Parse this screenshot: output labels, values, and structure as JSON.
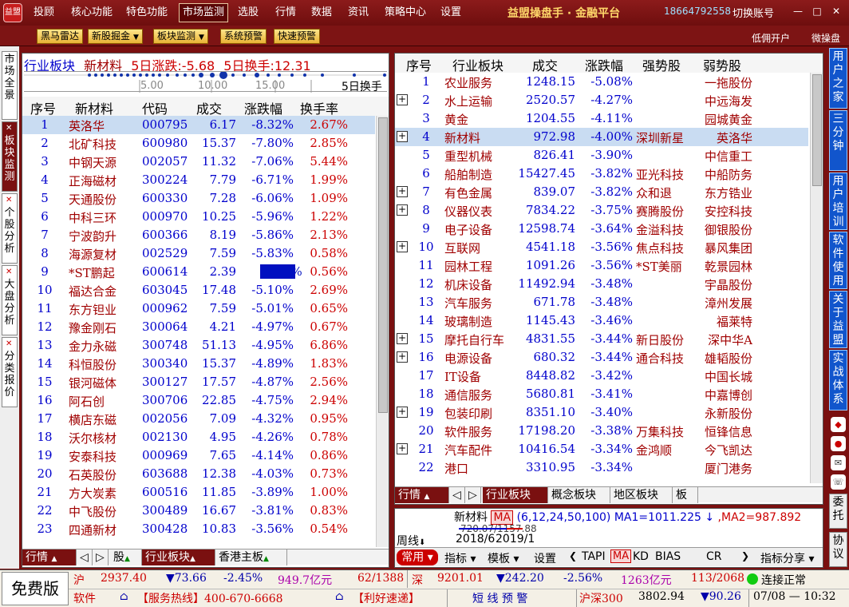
{
  "menu": {
    "logo": "益盟",
    "items": [
      "投顾",
      "核心功能",
      "特色功能",
      "市场监测",
      "选股",
      "行情",
      "数据",
      "资讯",
      "策略中心",
      "设置"
    ],
    "active": "市场监测",
    "brand": "益盟操盘手 · 金融平台",
    "phone": "18664792558",
    "switch_account": "切换账号",
    "window_buttons": [
      "—",
      "□",
      "✕"
    ]
  },
  "toolbar": {
    "buttons": [
      "黑马雷达",
      "新股掘金",
      "板块监测",
      "系统预警",
      "快速预警"
    ],
    "links": [
      "低佣开户",
      "微操盘"
    ]
  },
  "left_tabs": [
    {
      "label": "市场全景",
      "active": false
    },
    {
      "label": "板块监测",
      "active": true
    },
    {
      "label": "个股分析",
      "active": false
    },
    {
      "label": "大盘分析",
      "active": false
    },
    {
      "label": "分类报价",
      "active": false
    }
  ],
  "left_panel": {
    "title_parts": [
      "行业板块",
      "新材料",
      "5日涨跌:-5.68",
      "5日换手:12.31"
    ],
    "axis_ticks": [
      "5.00",
      "10.00",
      "15.00"
    ],
    "axis_label": "5日换手",
    "columns": [
      "序号",
      "新材料",
      "代码",
      "成交",
      "涨跌幅",
      "换手率"
    ],
    "rows": [
      [
        "1",
        "英洛华",
        "000795",
        "6.17",
        "-8.32%",
        "2.67%"
      ],
      [
        "2",
        "北矿科技",
        "600980",
        "15.37",
        "-7.80%",
        "2.85%"
      ],
      [
        "3",
        "中钢天源",
        "002057",
        "11.32",
        "-7.06%",
        "5.44%"
      ],
      [
        "4",
        "正海磁材",
        "300224",
        "7.79",
        "-6.71%",
        "1.99%"
      ],
      [
        "5",
        "天通股份",
        "600330",
        "7.28",
        "-6.06%",
        "1.09%"
      ],
      [
        "6",
        "中科三环",
        "000970",
        "10.25",
        "-5.96%",
        "1.22%"
      ],
      [
        "7",
        "宁波韵升",
        "600366",
        "8.19",
        "-5.86%",
        "2.13%"
      ],
      [
        "8",
        "海源复材",
        "002529",
        "7.59",
        "-5.83%",
        "0.58%"
      ],
      [
        "9",
        "*ST鹏起",
        "600614",
        "2.39",
        "-5.14%",
        "0.56%"
      ],
      [
        "10",
        "福达合金",
        "603045",
        "17.48",
        "-5.10%",
        "2.69%"
      ],
      [
        "11",
        "东方钽业",
        "000962",
        "7.59",
        "-5.01%",
        "0.65%"
      ],
      [
        "12",
        "豫金刚石",
        "300064",
        "4.21",
        "-4.97%",
        "0.67%"
      ],
      [
        "13",
        "金力永磁",
        "300748",
        "51.13",
        "-4.95%",
        "6.86%"
      ],
      [
        "14",
        "科恒股份",
        "300340",
        "15.37",
        "-4.89%",
        "1.83%"
      ],
      [
        "15",
        "银河磁体",
        "300127",
        "17.57",
        "-4.87%",
        "2.56%"
      ],
      [
        "16",
        "阿石创",
        "300706",
        "22.85",
        "-4.75%",
        "2.94%"
      ],
      [
        "17",
        "横店东磁",
        "002056",
        "7.09",
        "-4.32%",
        "0.95%"
      ],
      [
        "18",
        "沃尔核材",
        "002130",
        "4.95",
        "-4.26%",
        "0.78%"
      ],
      [
        "19",
        "安泰科技",
        "000969",
        "7.65",
        "-4.14%",
        "0.86%"
      ],
      [
        "20",
        "石英股份",
        "603688",
        "12.38",
        "-4.03%",
        "0.73%"
      ],
      [
        "21",
        "方大炭素",
        "600516",
        "11.85",
        "-3.89%",
        "1.00%"
      ],
      [
        "22",
        "中飞股份",
        "300489",
        "16.67",
        "-3.81%",
        "0.83%"
      ],
      [
        "23",
        "四通新材",
        "300428",
        "10.83",
        "-3.56%",
        "0.54%"
      ]
    ],
    "bottom_tabs": [
      "行情",
      "股",
      "行业板块",
      "香港主板"
    ]
  },
  "right_panel": {
    "columns": [
      "序号",
      "行业板块",
      "成交",
      "涨跌幅",
      "强势股",
      "弱势股"
    ],
    "rows": [
      [
        "1",
        "农业服务",
        "1248.15",
        "-5.08%",
        "",
        "一拖股份",
        false
      ],
      [
        "2",
        "水上运输",
        "2520.57",
        "-4.27%",
        "",
        "中远海发",
        true
      ],
      [
        "3",
        "黄金",
        "1204.55",
        "-4.11%",
        "",
        "园城黄金",
        false
      ],
      [
        "4",
        "新材料",
        "972.98",
        "-4.00%",
        "深圳新星",
        "英洛华",
        true
      ],
      [
        "5",
        "重型机械",
        "826.41",
        "-3.90%",
        "",
        "中信重工",
        false
      ],
      [
        "6",
        "船舶制造",
        "15427.45",
        "-3.82%",
        "亚光科技",
        "中船防务",
        false
      ],
      [
        "7",
        "有色金属",
        "839.07",
        "-3.82%",
        "众和退",
        "东方锆业",
        true
      ],
      [
        "8",
        "仪器仪表",
        "7834.22",
        "-3.75%",
        "赛腾股份",
        "安控科技",
        true
      ],
      [
        "9",
        "电子设备",
        "12598.74",
        "-3.64%",
        "金溢科技",
        "御银股份",
        false
      ],
      [
        "10",
        "互联网",
        "4541.18",
        "-3.56%",
        "焦点科技",
        "暴风集团",
        true
      ],
      [
        "11",
        "园林工程",
        "1091.26",
        "-3.56%",
        "*ST美丽",
        "乾景园林",
        false
      ],
      [
        "12",
        "机床设备",
        "11492.94",
        "-3.48%",
        "",
        "宇晶股份",
        false
      ],
      [
        "13",
        "汽车服务",
        "671.78",
        "-3.48%",
        "",
        "漳州发展",
        false
      ],
      [
        "14",
        "玻璃制造",
        "1145.43",
        "-3.46%",
        "",
        "福莱特",
        false
      ],
      [
        "15",
        "摩托自行车",
        "4831.55",
        "-3.44%",
        "新日股份",
        "深中华A",
        true
      ],
      [
        "16",
        "电源设备",
        "680.32",
        "-3.44%",
        "通合科技",
        "雄韬股份",
        true
      ],
      [
        "17",
        "IT设备",
        "8448.82",
        "-3.42%",
        "",
        "中国长城",
        false
      ],
      [
        "18",
        "通信服务",
        "5680.81",
        "-3.41%",
        "",
        "中嘉博创",
        false
      ],
      [
        "19",
        "包装印刷",
        "8351.10",
        "-3.40%",
        "",
        "永新股份",
        true
      ],
      [
        "20",
        "软件服务",
        "17198.20",
        "-3.38%",
        "万集科技",
        "恒锋信息",
        false
      ],
      [
        "21",
        "汽车配件",
        "10416.54",
        "-3.34%",
        "金鸿顺",
        "今飞凯达",
        true
      ],
      [
        "22",
        "港口",
        "3310.95",
        "-3.34%",
        "",
        "厦门港务",
        false
      ]
    ],
    "bottom_tabs": [
      "行情",
      "行业板块",
      "概念板块",
      "地区板块",
      "板"
    ]
  },
  "bottom_info": {
    "name": "新材料",
    "ma_label": "MA",
    "ma_params": "(6,12,24,50,100)",
    "ma1": "MA1=1011.225 ↓",
    "ma2": ",MA2=987.892",
    "price_hint": "720.07/1157.88",
    "period": "周线",
    "dates": [
      "2018/6",
      "2019/1"
    ],
    "tools": [
      "常用",
      "指标",
      "模板",
      "设置",
      "TAPI",
      "MA",
      "KD",
      "BIAS",
      "CR",
      "指标分享"
    ]
  },
  "right_tabs": [
    "用户之家",
    "三分钟",
    "用户培训",
    "软件使用",
    "关于益盟",
    "实战体系"
  ],
  "right_extra": [
    "委托",
    "协议"
  ],
  "status": {
    "free": "免费版",
    "sh_label": "沪",
    "sh_index": "2937.40",
    "sh_change": "▼73.66",
    "sh_pct": "-2.45%",
    "sh_amount": "949.7亿元",
    "sh_updown": "62/1388",
    "sz_label": "深",
    "sz_index": "9201.01",
    "sz_change": "▼242.20",
    "sz_pct": "-2.56%",
    "sz_amount": "1263亿元",
    "sz_updown": "113/2068",
    "connection": "连接正常",
    "software": "软件",
    "hotline": "【服务热线】400-670-6668",
    "express": "【利好速递】",
    "warning": "短 线 预 警",
    "hs300_label": "沪深300",
    "hs300": "3802.94",
    "hs300_change": "▼90.26",
    "datetime": "07/08 — 10:32"
  },
  "colors": {
    "frame": "#7a1010",
    "up": "#c00000",
    "stock_name": "#a00000",
    "code": "#0000cc",
    "select_row": "#c9dcf2"
  }
}
